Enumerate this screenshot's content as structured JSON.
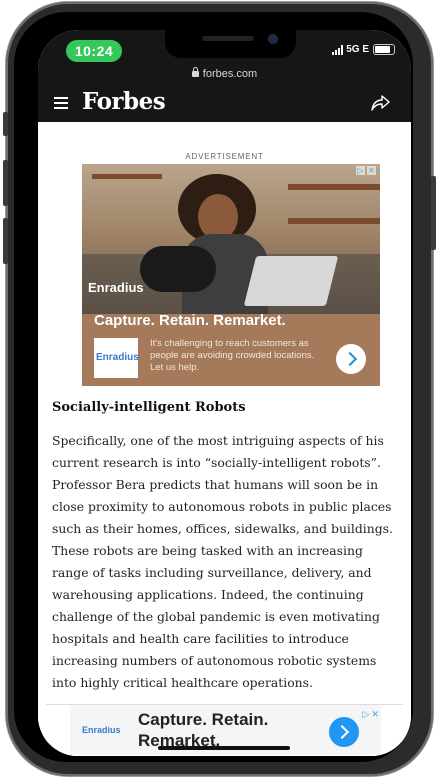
{
  "status_bar": {
    "time": "10:24",
    "network": "5G E"
  },
  "browser": {
    "url": "forbes.com"
  },
  "header": {
    "logo": "Forbes"
  },
  "ad_top": {
    "label": "ADVERTISEMENT",
    "brand": "Enradius",
    "headline": "Capture. Retain. Remarket.",
    "copy": "It's challenging to reach customers as people are avoiding crowded locations. Let us help.",
    "close_glyphs": [
      "▷",
      "✕"
    ]
  },
  "article": {
    "heading": "Socially-intelligent Robots",
    "paragraph": "Specifically, one of the most intriguing aspects of his current research is into “socially-intelligent robots”. Professor Bera predicts that humans will soon be in close proximity to autonomous robots in public places such as their homes, offices, sidewalks, and buildings. These robots are being tasked with an increasing range of tasks including surveillance, delivery, and warehousing applications. Indeed, the continuing challenge of the global pandemic is even motivating hospitals and health care facilities to introduce increasing numbers of autonomous robotic systems into highly critical healthcare operations."
  },
  "ad_bottom": {
    "brand": "Enradius",
    "headline": "Capture. Retain. Remarket.",
    "close_glyphs": [
      "▷",
      "✕"
    ]
  },
  "icons": [
    "menu-icon",
    "share-icon",
    "lock-icon",
    "battery-icon",
    "signal-icon",
    "arrow-right-icon"
  ]
}
